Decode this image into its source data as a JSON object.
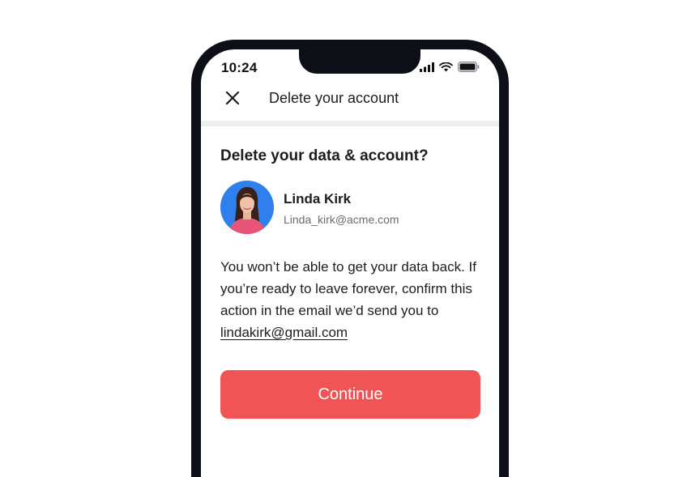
{
  "status_bar": {
    "time": "10:24"
  },
  "header": {
    "title": "Delete your account",
    "close_icon": "close-icon"
  },
  "content": {
    "heading": "Delete your data & account?",
    "user": {
      "name": "Linda Kirk",
      "email": "Linda_kirk@acme.com"
    },
    "message_before_link": "You won’t be able to get your data back. If you’re ready to leave forever, confirm this action in the email we’d send you to ",
    "message_link": "lindakirk@gmail.com"
  },
  "actions": {
    "continue_label": "Continue"
  },
  "colors": {
    "accent": "#f05454",
    "avatar_bg": "#2f80ed",
    "frame": "#0d0f17"
  }
}
